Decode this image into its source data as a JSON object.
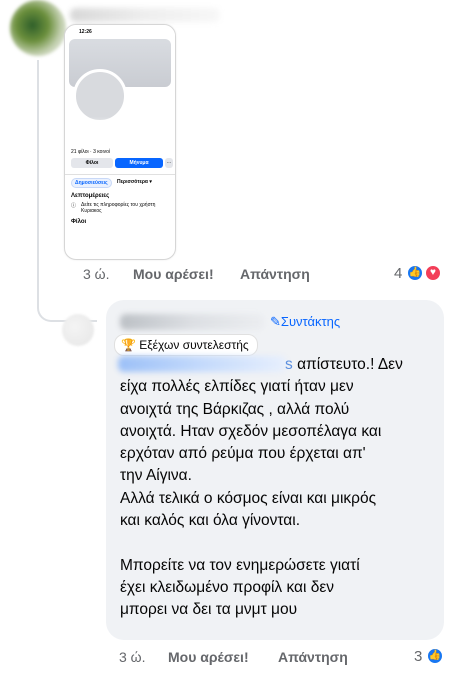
{
  "phone_screenshot": {
    "time": "12:26",
    "stats": "21 φίλοι · 3 κοινοί",
    "friends_button": "Φίλοι",
    "message_button": "Μήνυμα",
    "more_button": "···",
    "tab_posts": "Δημοσιεύσεις",
    "tab_more": "Περισσότερα ▾",
    "details_title": "Λεπτομέρειες",
    "details_text": "Δείτε τις πληροφορίες του χρήστη Κυριακος",
    "friends_title": "Φίλοι"
  },
  "comment": {
    "time": "3 ώ.",
    "like_action": "Μου αρέσει!",
    "reply_action": "Απάντηση",
    "reaction_count": "4"
  },
  "reply": {
    "author_badge": "Συντάκτης",
    "top_contributor": "Εξέχων συντελεστής",
    "tag_tail": "s",
    "text": "απίστευτο.! Δεν\nείχα πολλές ελπίδες γιατί ήταν μεν\nανοιχτά της Βάρκιζας , αλλά πολύ\nανοιχτά. Ηταν σχεδόν μεσοπέλαγα και\nερχόταν από ρεύμα που έρχεται απ'\nτην Αίγινα.\nΑλλά τελικά ο κόσμος είναι και μικρός\nκαι καλός και όλα γίνονται.\n\nΜπορείτε να τον ενημερώσετε γιατί\nέχει κλειδωμένο προφίλ και δεν\nμπορει να δει τα μνμτ μου",
    "time": "3 ώ.",
    "like_action": "Μου αρέσει!",
    "reply_action": "Απάντηση",
    "reaction_count": "3"
  },
  "colors": {
    "accent": "#0866ff",
    "bubble": "#f0f2f5",
    "meta": "#65676b",
    "love": "#f33e58"
  }
}
